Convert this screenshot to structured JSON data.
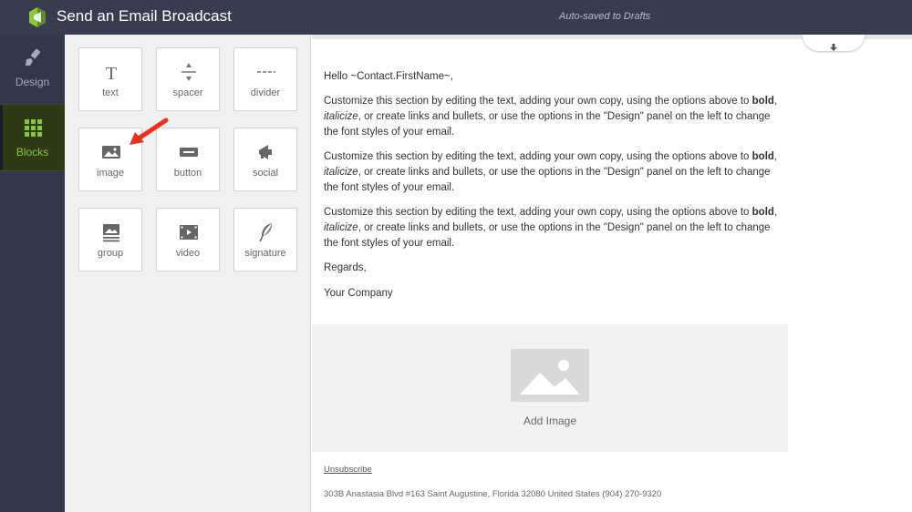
{
  "header": {
    "title": "Send an Email Broadcast",
    "autosave_status": "Auto-saved to Drafts"
  },
  "rail": {
    "items": [
      {
        "label": "Design",
        "icon": "brush-icon"
      },
      {
        "label": "Blocks",
        "icon": "grid-icon",
        "active": true
      }
    ]
  },
  "blocks": {
    "tiles": [
      {
        "label": "text",
        "icon": "text-icon"
      },
      {
        "label": "spacer",
        "icon": "spacer-icon"
      },
      {
        "label": "divider",
        "icon": "divider-icon"
      },
      {
        "label": "image",
        "icon": "image-icon"
      },
      {
        "label": "button",
        "icon": "button-icon"
      },
      {
        "label": "social",
        "icon": "megaphone-icon"
      },
      {
        "label": "group",
        "icon": "group-icon"
      },
      {
        "label": "video",
        "icon": "video-icon"
      },
      {
        "label": "signature",
        "icon": "feather-icon"
      }
    ]
  },
  "email": {
    "greeting": "Hello ~Contact.FirstName~,",
    "paragraph": {
      "part1": "Customize this section by editing the text, adding your own copy, using the options above to ",
      "bold": "bold",
      "part2": ", ",
      "italic": "italicize",
      "part3": ", or create links and bullets, or use the options in the \"Design\" panel on the left to change the font styles of your email."
    },
    "regards": "Regards,",
    "company": "Your Company",
    "add_image_label": "Add Image",
    "unsubscribe": "Unsubscribe",
    "address": "303B Anastasia Blvd #163 Saint Augustine, Florida 32080 United States (904) 270-9320"
  },
  "colors": {
    "topbar": "#383c4e",
    "rail": "#33374a",
    "accent_green": "#8cc63f",
    "arrow_red": "#e8311f"
  }
}
